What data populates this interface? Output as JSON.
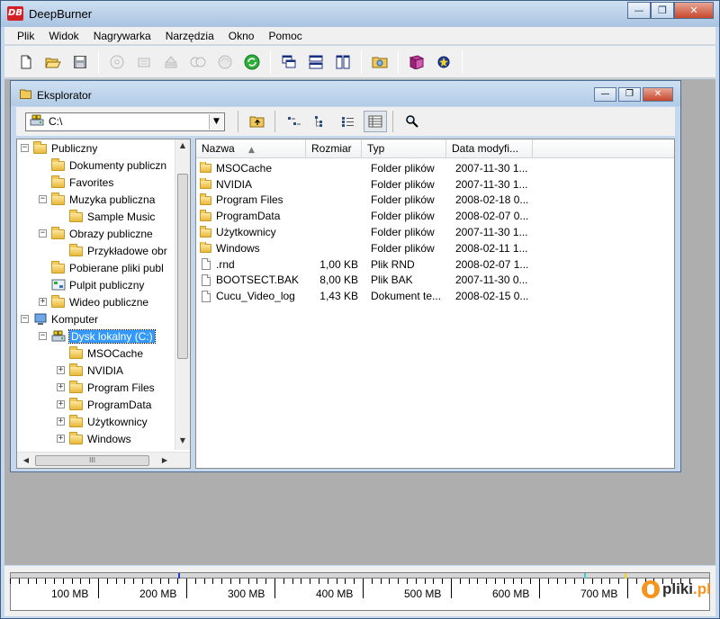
{
  "app": {
    "title": "DeepBurner",
    "logo_text": "DB"
  },
  "window_buttons": {
    "minimize": "—",
    "restore": "❐",
    "close": "✕"
  },
  "menu": [
    "Plik",
    "Widok",
    "Nagrywarka",
    "Narzędzia",
    "Okno",
    "Pomoc"
  ],
  "toolbar_icons": [
    "new-icon",
    "open-icon",
    "save-icon",
    "burn-disc-icon",
    "erase-icon",
    "eject-icon",
    "copy-disc-icon",
    "refresh-icon",
    "cascade-icon",
    "tile-horizontal-icon",
    "tile-vertical-icon",
    "explorer-icon",
    "book-icon",
    "about-icon"
  ],
  "explorer": {
    "title": "Eksplorator",
    "path": "C:\\",
    "toolbar_icons": [
      "up-folder-icon",
      "small-icons-view-icon",
      "list-view-icon",
      "tree-view-icon",
      "details-view-icon",
      "search-icon"
    ]
  },
  "tree": [
    {
      "label": "Publiczny",
      "depth": 0,
      "expander": "−",
      "icon": "folder"
    },
    {
      "label": "Dokumenty publiczn",
      "depth": 1,
      "expander": "",
      "icon": "folder"
    },
    {
      "label": "Favorites",
      "depth": 1,
      "expander": "",
      "icon": "folder"
    },
    {
      "label": "Muzyka publiczna",
      "depth": 1,
      "expander": "−",
      "icon": "folder"
    },
    {
      "label": "Sample Music",
      "depth": 2,
      "expander": "",
      "icon": "folder"
    },
    {
      "label": "Obrazy publiczne",
      "depth": 1,
      "expander": "−",
      "icon": "folder"
    },
    {
      "label": "Przykładowe obr",
      "depth": 2,
      "expander": "",
      "icon": "folder"
    },
    {
      "label": "Pobierane pliki publ",
      "depth": 1,
      "expander": "",
      "icon": "folder"
    },
    {
      "label": "Pulpit publiczny",
      "depth": 1,
      "expander": "",
      "icon": "desktop"
    },
    {
      "label": "Wideo publiczne",
      "depth": 1,
      "expander": "+",
      "icon": "folder"
    },
    {
      "label": "Komputer",
      "depth": 0,
      "expander": "−",
      "icon": "computer"
    },
    {
      "label": "Dysk lokalny (C:)",
      "depth": 1,
      "expander": "−",
      "icon": "drive",
      "selected": true
    },
    {
      "label": "MSOCache",
      "depth": 2,
      "expander": "",
      "icon": "folder"
    },
    {
      "label": "NVIDIA",
      "depth": 2,
      "expander": "+",
      "icon": "folder"
    },
    {
      "label": "Program Files",
      "depth": 2,
      "expander": "+",
      "icon": "folder"
    },
    {
      "label": "ProgramData",
      "depth": 2,
      "expander": "+",
      "icon": "folder"
    },
    {
      "label": "Użytkownicy",
      "depth": 2,
      "expander": "+",
      "icon": "folder"
    },
    {
      "label": "Windows",
      "depth": 2,
      "expander": "+",
      "icon": "folder"
    }
  ],
  "file_list": {
    "columns": [
      "Nazwa",
      "Rozmiar",
      "Typ",
      "Data modyfi..."
    ],
    "rows": [
      {
        "name": "MSOCache",
        "size": "",
        "type": "Folder plików",
        "date": "2007-11-30 1...",
        "kind": "folder"
      },
      {
        "name": "NVIDIA",
        "size": "",
        "type": "Folder plików",
        "date": "2007-11-30 1...",
        "kind": "folder"
      },
      {
        "name": "Program Files",
        "size": "",
        "type": "Folder plików",
        "date": "2008-02-18 0...",
        "kind": "folder"
      },
      {
        "name": "ProgramData",
        "size": "",
        "type": "Folder plików",
        "date": "2008-02-07 0...",
        "kind": "folder"
      },
      {
        "name": "Użytkownicy",
        "size": "",
        "type": "Folder plików",
        "date": "2007-11-30 1...",
        "kind": "folder"
      },
      {
        "name": "Windows",
        "size": "",
        "type": "Folder plików",
        "date": "2008-02-11 1...",
        "kind": "folder"
      },
      {
        "name": ".rnd",
        "size": "1,00 KB",
        "type": "Plik RND",
        "date": "2008-02-07 1...",
        "kind": "file"
      },
      {
        "name": "BOOTSECT.BAK",
        "size": "8,00 KB",
        "type": "Plik BAK",
        "date": "2007-11-30 0...",
        "kind": "file"
      },
      {
        "name": "Cucu_Video_log",
        "size": "1,43 KB",
        "type": "Dokument te...",
        "date": "2008-02-15 0...",
        "kind": "file"
      }
    ]
  },
  "capacity_ruler": {
    "labels": [
      "100 MB",
      "200 MB",
      "300 MB",
      "400 MB",
      "500 MB",
      "600 MB",
      "700 MB"
    ],
    "marker_colors": [
      "#1f3fd6",
      "#38c9e0",
      "#f2d21c"
    ]
  },
  "watermark": {
    "brand": "pliki",
    "tld": ".pl"
  }
}
